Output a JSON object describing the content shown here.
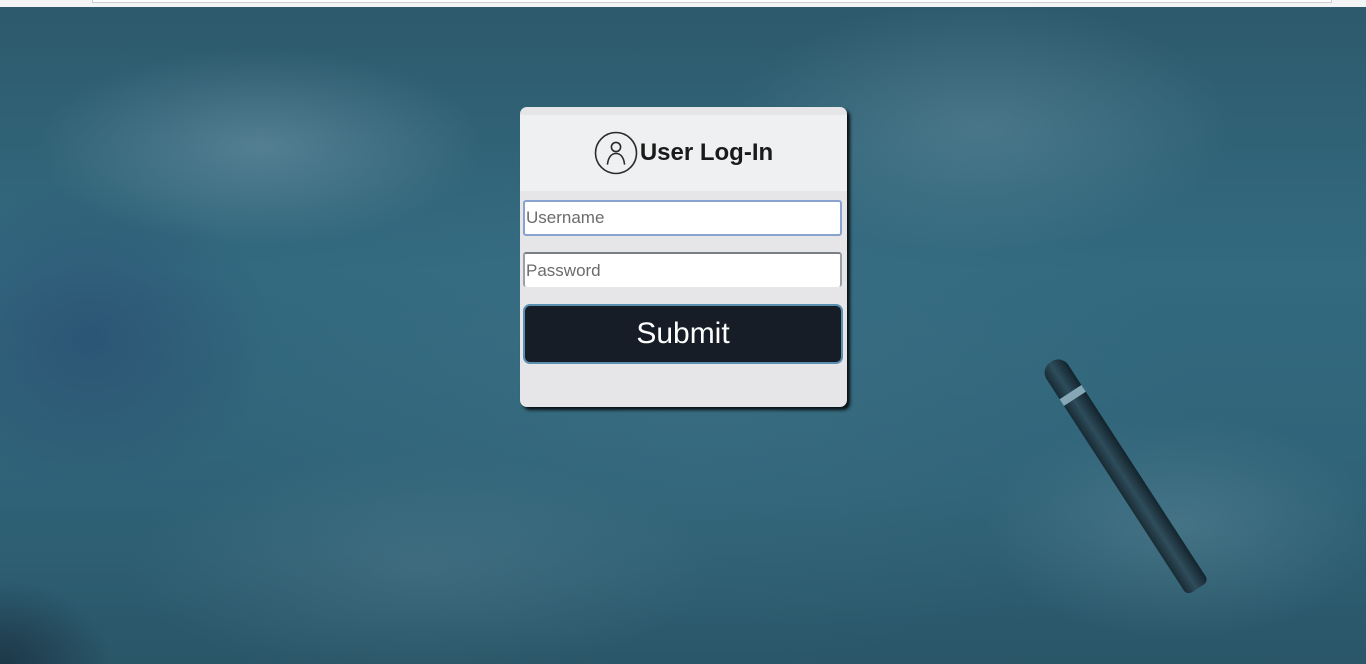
{
  "login": {
    "title": "User Log-In",
    "username_placeholder": "Username",
    "password_placeholder": "Password",
    "submit_label": "Submit"
  },
  "icons": {
    "header": "user-circle-icon"
  },
  "colors": {
    "background": "#2f5f72",
    "card": "#e6e6e9",
    "card_header": "#eff0f2",
    "button": "#161d27",
    "button_border": "#5b8fb0",
    "focus_border": "#8aa2cf"
  }
}
